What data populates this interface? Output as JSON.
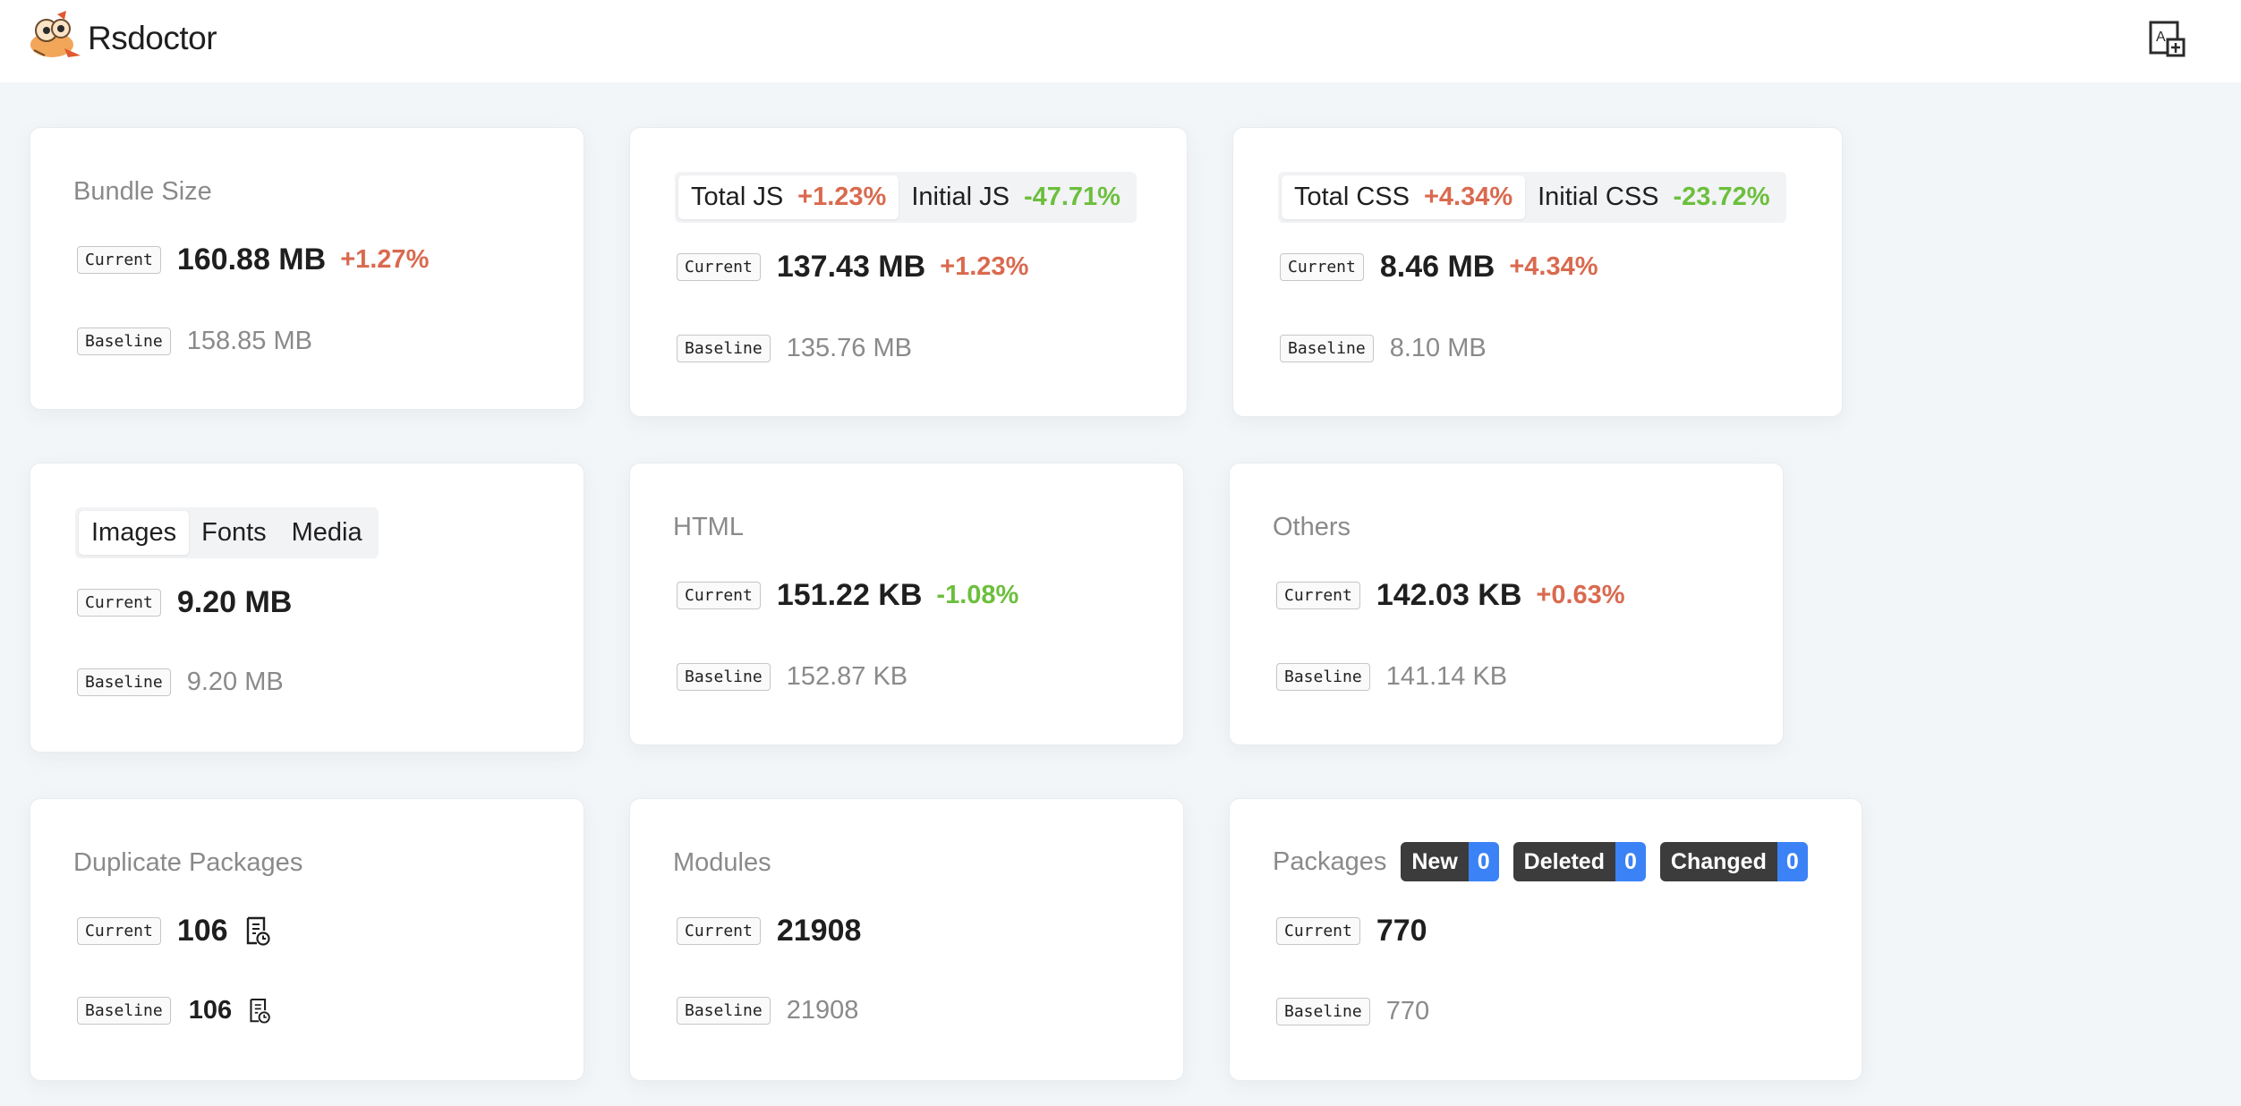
{
  "header": {
    "app_title": "Rsdoctor",
    "logo_icon": "rsdoctor-logo-icon",
    "lang_icon": "translate-icon"
  },
  "colors": {
    "increase": "#d96a4f",
    "decrease": "#6cbf3c",
    "badge_dark": "#3c3c3c",
    "badge_blue": "#3b82f6"
  },
  "tags": {
    "current": "Current",
    "baseline": "Baseline"
  },
  "cards": {
    "bundle_size": {
      "title": "Bundle Size",
      "current": "160.88 MB",
      "change": "+1.27%",
      "baseline": "158.85 MB"
    },
    "js": {
      "tabs": [
        {
          "label": "Total JS",
          "change": "+1.23%"
        },
        {
          "label": "Initial JS",
          "change": "-47.71%"
        }
      ],
      "current": "137.43 MB",
      "change": "+1.23%",
      "baseline": "135.76 MB"
    },
    "css": {
      "tabs": [
        {
          "label": "Total CSS",
          "change": "+4.34%"
        },
        {
          "label": "Initial CSS",
          "change": "-23.72%"
        }
      ],
      "current": "8.46 MB",
      "change": "+4.34%",
      "baseline": "8.10 MB"
    },
    "assets": {
      "tabs": [
        "Images",
        "Fonts",
        "Media"
      ],
      "current": "9.20 MB",
      "baseline": "9.20 MB"
    },
    "html": {
      "title": "HTML",
      "current": "151.22 KB",
      "change": "-1.08%",
      "baseline": "152.87 KB"
    },
    "others": {
      "title": "Others",
      "current": "142.03 KB",
      "change": "+0.63%",
      "baseline": "141.14 KB"
    },
    "duplicate": {
      "title": "Duplicate Packages",
      "current": "106",
      "baseline": "106",
      "icon": "document-clock-icon"
    },
    "modules": {
      "title": "Modules",
      "current": "21908",
      "baseline": "21908"
    },
    "packages": {
      "title": "Packages",
      "badges": [
        {
          "label": "New",
          "count": "0"
        },
        {
          "label": "Deleted",
          "count": "0"
        },
        {
          "label": "Changed",
          "count": "0"
        }
      ],
      "current": "770",
      "baseline": "770"
    }
  }
}
